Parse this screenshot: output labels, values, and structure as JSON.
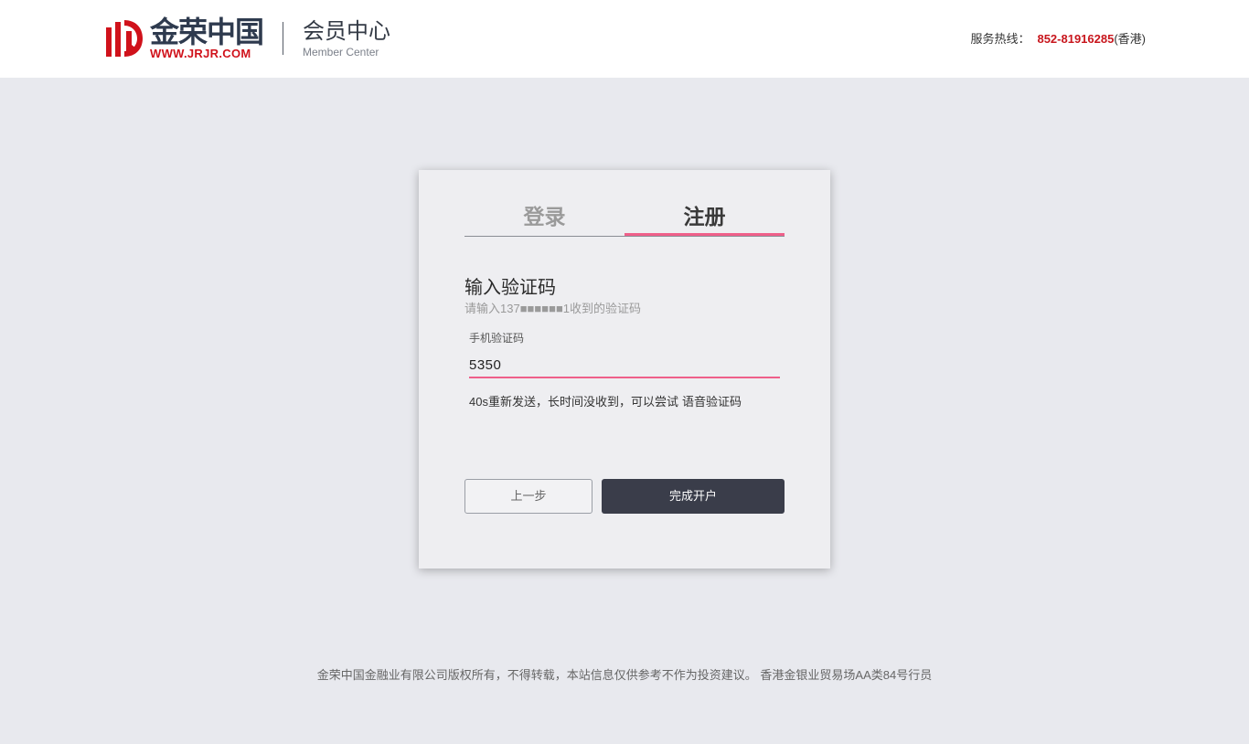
{
  "header": {
    "logo_cn": "金荣中国",
    "logo_url": "WWW.JRJR.COM",
    "member_cn": "会员中心",
    "member_en": "Member Center",
    "hotline_label": "服务热线：",
    "hotline_number": "852-81916285",
    "hotline_region": "(香港)",
    "brand_red": "#d0121b",
    "brand_navy": "#2e3a4e"
  },
  "tabs": [
    {
      "label": "登录",
      "active": false
    },
    {
      "label": "注册",
      "active": true
    }
  ],
  "form": {
    "title": "输入验证码",
    "subtitle": "请输入137■■■■■■1收到的验证码",
    "field_label": "手机验证码",
    "code_value": "5350",
    "resend_text": "40s重新发送，长时间没收到，可以尝试",
    "voice_link": "语音验证码",
    "back_button": "上一步",
    "finish_button": "完成开户"
  },
  "colors": {
    "accent_pink": "#ef5f8a",
    "button_dark": "#3a3d4a",
    "page_bg": "#e8e9ee"
  },
  "footer": {
    "text": "金荣中国金融业有限公司版权所有，不得转载，本站信息仅供参考不作为投资建议。 香港金银业贸易场AA类84号行员"
  }
}
